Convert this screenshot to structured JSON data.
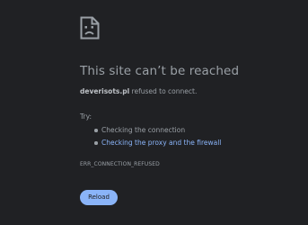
{
  "error": {
    "icon": "sad-page-icon",
    "title": "This site can’t be reached",
    "host": "deverisots.pl",
    "message_suffix": " refused to connect.",
    "try_label": "Try:",
    "suggestions": [
      {
        "label": "Checking the connection",
        "is_link": false
      },
      {
        "label": "Checking the proxy and the firewall",
        "is_link": true
      }
    ],
    "error_code": "ERR_CONNECTION_REFUSED"
  },
  "reload_button": {
    "label": "Reload"
  },
  "colors": {
    "background": "#202124",
    "text": "#9aa0a6",
    "link": "#8ab4f8",
    "button": "#8ab4f8"
  }
}
